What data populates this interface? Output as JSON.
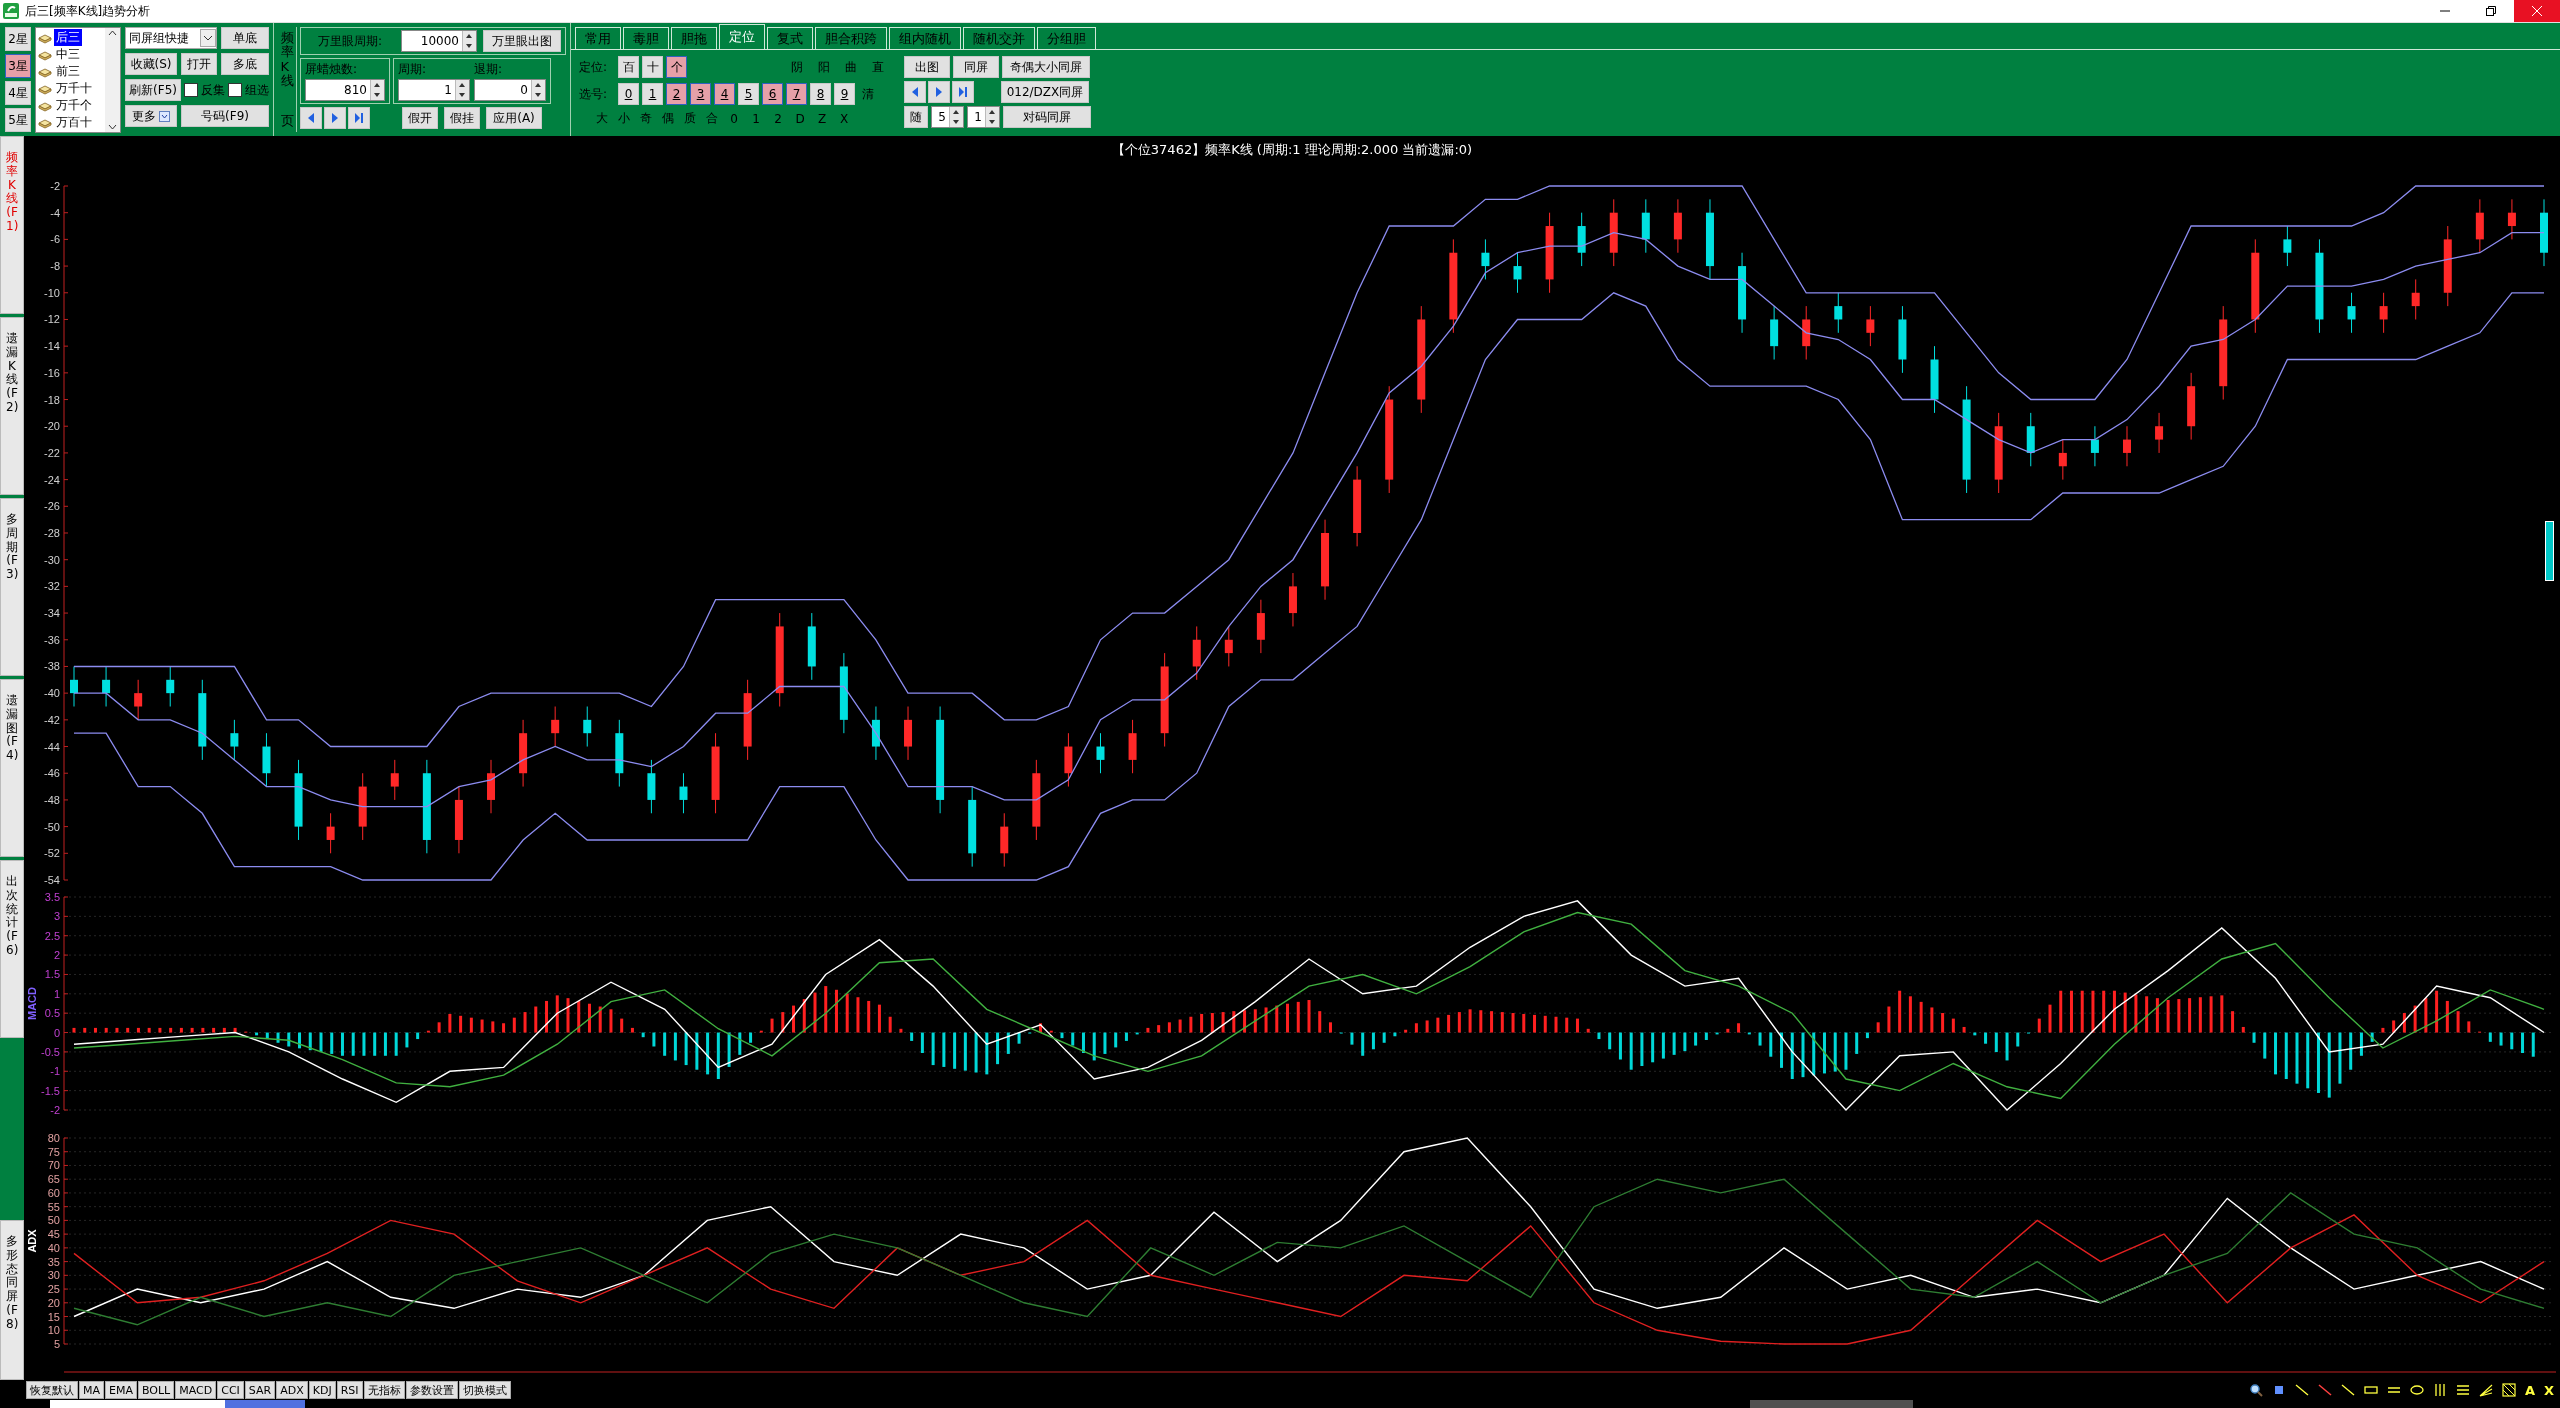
{
  "window": {
    "title": "后三[频率K线]趋势分析"
  },
  "star_buttons": [
    {
      "label": "2星",
      "selected": false
    },
    {
      "label": "3星",
      "selected": true
    },
    {
      "label": "4星",
      "selected": false
    },
    {
      "label": "5星",
      "selected": false
    }
  ],
  "position_list": [
    {
      "label": "后三",
      "selected": true
    },
    {
      "label": "中三",
      "selected": false
    },
    {
      "label": "前三",
      "selected": false
    },
    {
      "label": "万千十",
      "selected": false
    },
    {
      "label": "万千个",
      "selected": false
    },
    {
      "label": "万百十",
      "selected": false
    }
  ],
  "quick_select": {
    "value": "同屏组快捷"
  },
  "buttons": {
    "single": "单底",
    "favorite": "收藏(S)",
    "open": "打开",
    "multi": "多底",
    "refresh": "刷新(F5)",
    "more": "更多",
    "number": "号码(F9)"
  },
  "checkboxes": [
    {
      "label": "反集",
      "checked": false
    },
    {
      "label": "组选",
      "checked": false
    }
  ],
  "frequency_panel": {
    "vertical_label": "频率K线",
    "page_label": "页",
    "wanliyan_label": "万里眼周期:",
    "wanliyan_value": "10000",
    "wanliyan_button": "万里眼出图",
    "candles_label": "屏蜡烛数:",
    "candles_value": "810",
    "period_label": "周期:",
    "period_value": "1",
    "back_label": "退期:",
    "back_value": "0",
    "actions": [
      "假开",
      "假挂",
      "应用(A)"
    ]
  },
  "tabs": [
    {
      "label": "常用",
      "selected": false
    },
    {
      "label": "毒胆",
      "selected": false
    },
    {
      "label": "胆拖",
      "selected": false
    },
    {
      "label": "定位",
      "selected": true
    },
    {
      "label": "复式",
      "selected": false
    },
    {
      "label": "胆合积跨",
      "selected": false
    },
    {
      "label": "组内随机",
      "selected": false
    },
    {
      "label": "随机交并",
      "selected": false
    },
    {
      "label": "分组胆",
      "selected": false
    }
  ],
  "position": {
    "label": "定位:",
    "digits": [
      {
        "label": "百",
        "selected": false
      },
      {
        "label": "十",
        "selected": false
      },
      {
        "label": "个",
        "selected": true
      }
    ],
    "shape_labels": [
      "阴",
      "阳",
      "曲",
      "直"
    ],
    "pick_label": "选号:",
    "numbers": [
      {
        "label": "0",
        "selected": false
      },
      {
        "label": "1",
        "selected": false
      },
      {
        "label": "2",
        "selected": true
      },
      {
        "label": "3",
        "selected": true
      },
      {
        "label": "4",
        "selected": true
      },
      {
        "label": "5",
        "selected": false
      },
      {
        "label": "6",
        "selected": true
      },
      {
        "label": "7",
        "selected": true
      },
      {
        "label": "8",
        "selected": false
      },
      {
        "label": "9",
        "selected": false
      }
    ],
    "clear": "清",
    "filters": [
      "大",
      "小",
      "奇",
      "偶",
      "质",
      "合",
      "0",
      "1",
      "2",
      "D",
      "Z",
      "X"
    ],
    "right_buttons": {
      "chart": "出图",
      "same": "同屏",
      "parity": "奇偶大小同屏",
      "dzx": "012/DZX同屏",
      "random": "随",
      "spin1": "5",
      "spin2": "1",
      "pair": "对码同屏"
    }
  },
  "side_tabs": [
    {
      "label": "频率K线(F1)",
      "selected": true
    },
    {
      "label": "遗漏K线(F2)",
      "selected": false
    },
    {
      "label": "多周期(F3)",
      "selected": false
    },
    {
      "label": "遗漏图(F4)",
      "selected": false
    },
    {
      "label": "出次统计(F6)",
      "selected": false
    },
    {
      "label": "多形态同屏(F8)",
      "selected": false
    }
  ],
  "chart_title": "【个位37462】频率K线 (周期:1 理论周期:2.000 当前遗漏:0)",
  "main_chart": {
    "chart_data": {
      "type": "candlestick",
      "ylim": [
        -54,
        -2
      ],
      "yticks": [
        -2,
        -4,
        -6,
        -8,
        -10,
        -12,
        -14,
        -16,
        -18,
        -20,
        -22,
        -24,
        -26,
        -28,
        -30,
        -32,
        -34,
        -36,
        -38,
        -40,
        -42,
        -44,
        -46,
        -48,
        -50,
        -52,
        -54
      ],
      "categories": [
        null,
        null,
        null,
        null,
        null,
        null,
        null,
        null,
        null,
        null,
        null,
        null,
        null,
        null,
        null,
        null,
        null,
        null,
        null,
        null,
        null,
        null,
        null,
        null,
        null,
        null,
        null,
        null,
        null,
        null,
        null,
        null,
        null,
        null,
        null,
        null,
        null,
        null,
        null,
        null,
        null,
        null,
        null,
        null,
        null,
        null,
        null,
        null,
        null,
        null,
        null,
        null,
        null,
        null,
        null,
        null,
        null,
        null,
        null,
        null,
        null,
        null,
        null,
        null,
        null,
        null,
        null,
        null,
        null,
        null,
        null,
        null,
        null,
        null,
        null,
        null,
        null,
        null
      ],
      "series": [
        {
          "type": "line",
          "color": "#8c8cf0",
          "values": [
            -38,
            -38,
            -38,
            -38,
            -38,
            -38,
            -42,
            -42,
            -44,
            -44,
            -44,
            -44,
            -41,
            -40,
            -40,
            -40,
            -40,
            -40,
            -41,
            -38,
            -33,
            -33,
            -33,
            -33,
            -33,
            -36,
            -40,
            -40,
            -40,
            -42,
            -42,
            -41,
            -36,
            -34,
            -34,
            -32,
            -30,
            -26,
            -22,
            -16,
            -10,
            -5,
            -5,
            -5,
            -3,
            -3,
            -2,
            -2,
            -2,
            -2,
            -2,
            -2,
            -2,
            -6,
            -10,
            -10,
            -10,
            -10,
            -10,
            -13,
            -16,
            -18,
            -18,
            -18,
            -15,
            -10,
            -5,
            -5,
            -5,
            -5,
            -5,
            -5,
            -4,
            -2,
            -2,
            -2,
            -2,
            -2
          ]
        },
        {
          "type": "line",
          "color": "#8c8cf0",
          "values": [
            -40,
            -40,
            -42,
            -42,
            -43,
            -45,
            -47,
            -47,
            -48,
            -48.5,
            -48.5,
            -48.5,
            -47,
            -46.5,
            -45,
            -44,
            -45,
            -45,
            -45.5,
            -44,
            -41.5,
            -41.5,
            -39.5,
            -39.5,
            -39.5,
            -43,
            -47,
            -47,
            -47,
            -48,
            -48,
            -46.5,
            -42,
            -40.5,
            -40.5,
            -38.5,
            -35,
            -32,
            -30,
            -26,
            -22,
            -17.5,
            -15.5,
            -12.5,
            -8.5,
            -7,
            -6.5,
            -6.5,
            -5.5,
            -6,
            -8,
            -9,
            -9,
            -11,
            -13,
            -13.5,
            -15,
            -18,
            -18,
            -19.5,
            -21,
            -22,
            -21,
            -21,
            -19.5,
            -17,
            -14,
            -13.5,
            -12,
            -9.5,
            -9.5,
            -9.5,
            -9,
            -8,
            -7.5,
            -7,
            -5.5,
            -5.5
          ]
        },
        {
          "type": "line",
          "color": "#8c8cf0",
          "values": [
            -43,
            -43,
            -47,
            -47,
            -49,
            -53,
            -53,
            -53,
            -53,
            -54,
            -54,
            -54,
            -54,
            -54,
            -51,
            -49,
            -51,
            -51,
            -51,
            -51,
            -51,
            -51,
            -47,
            -47,
            -47,
            -51,
            -54,
            -54,
            -54,
            -54,
            -54,
            -53,
            -49,
            -48,
            -48,
            -46,
            -41,
            -39,
            -39,
            -37,
            -35,
            -31,
            -27,
            -21,
            -15,
            -12,
            -12,
            -12,
            -10,
            -11,
            -15,
            -17,
            -17,
            -17,
            -17,
            -18,
            -21,
            -27,
            -27,
            -27,
            -27,
            -27,
            -25,
            -25,
            -25,
            -25,
            -24,
            -23,
            -20,
            -15,
            -15,
            -15,
            -15,
            -15,
            -14,
            -13,
            -10,
            -10
          ]
        }
      ],
      "ohlc": [
        [
          -39,
          -38,
          -41,
          -40
        ],
        [
          -39,
          -38,
          -41,
          -40
        ],
        [
          -41,
          -39,
          -42,
          -40
        ],
        [
          -39,
          -38,
          -41,
          -40
        ],
        [
          -40,
          -39,
          -45,
          -44
        ],
        [
          -43,
          -42,
          -45,
          -44
        ],
        [
          -44,
          -43,
          -47,
          -46
        ],
        [
          -46,
          -45,
          -51,
          -50
        ],
        [
          -51,
          -49,
          -52,
          -50
        ],
        [
          -50,
          -46,
          -51,
          -47
        ],
        [
          -47,
          -45,
          -48,
          -46
        ],
        [
          -46,
          -45,
          -52,
          -51
        ],
        [
          -51,
          -47,
          -52,
          -48
        ],
        [
          -48,
          -45,
          -49,
          -46
        ],
        [
          -46,
          -42,
          -47,
          -43
        ],
        [
          -43,
          -41,
          -44,
          -42
        ],
        [
          -42,
          -41,
          -44,
          -43
        ],
        [
          -43,
          -42,
          -47,
          -46
        ],
        [
          -46,
          -45,
          -49,
          -48
        ],
        [
          -47,
          -46,
          -49,
          -48
        ],
        [
          -48,
          -43,
          -49,
          -44
        ],
        [
          -44,
          -39,
          -45,
          -40
        ],
        [
          -40,
          -34,
          -41,
          -35
        ],
        [
          -35,
          -34,
          -39,
          -38
        ],
        [
          -38,
          -37,
          -43,
          -42
        ],
        [
          -42,
          -41,
          -45,
          -44
        ],
        [
          -44,
          -41,
          -45,
          -42
        ],
        [
          -42,
          -41,
          -49,
          -48
        ],
        [
          -48,
          -47,
          -53,
          -52
        ],
        [
          -52,
          -49,
          -53,
          -50
        ],
        [
          -50,
          -45,
          -51,
          -46
        ],
        [
          -46,
          -43,
          -47,
          -44
        ],
        [
          -44,
          -43,
          -46,
          -45
        ],
        [
          -45,
          -42,
          -46,
          -43
        ],
        [
          -43,
          -37,
          -44,
          -38
        ],
        [
          -38,
          -35,
          -39,
          -36
        ],
        [
          -37,
          -35,
          -38,
          -36
        ],
        [
          -36,
          -33,
          -37,
          -34
        ],
        [
          -34,
          -31,
          -35,
          -32
        ],
        [
          -32,
          -27,
          -33,
          -28
        ],
        [
          -28,
          -23,
          -29,
          -24
        ],
        [
          -24,
          -17,
          -25,
          -18
        ],
        [
          -18,
          -11,
          -19,
          -12
        ],
        [
          -12,
          -6,
          -13,
          -7
        ],
        [
          -7,
          -6,
          -9,
          -8
        ],
        [
          -8,
          -7,
          -10,
          -9
        ],
        [
          -9,
          -4,
          -10,
          -5
        ],
        [
          -5,
          -4,
          -8,
          -7
        ],
        [
          -7,
          -3,
          -8,
          -4
        ],
        [
          -4,
          -3,
          -7,
          -6
        ],
        [
          -6,
          -3,
          -7,
          -4
        ],
        [
          -4,
          -3,
          -9,
          -8
        ],
        [
          -8,
          -7,
          -13,
          -12
        ],
        [
          -12,
          -11,
          -15,
          -14
        ],
        [
          -14,
          -11,
          -15,
          -12
        ],
        [
          -11,
          -10,
          -13,
          -12
        ],
        [
          -13,
          -11,
          -14,
          -12
        ],
        [
          -12,
          -11,
          -16,
          -15
        ],
        [
          -15,
          -14,
          -19,
          -18
        ],
        [
          -18,
          -17,
          -25,
          -24
        ],
        [
          -24,
          -19,
          -25,
          -20
        ],
        [
          -20,
          -19,
          -23,
          -22
        ],
        [
          -23,
          -21,
          -24,
          -22
        ],
        [
          -21,
          -20,
          -23,
          -22
        ],
        [
          -22,
          -20,
          -23,
          -21
        ],
        [
          -21,
          -19,
          -22,
          -20
        ],
        [
          -20,
          -16,
          -21,
          -17
        ],
        [
          -17,
          -11,
          -18,
          -12
        ],
        [
          -12,
          -6,
          -13,
          -7
        ],
        [
          -6,
          -5,
          -8,
          -7
        ],
        [
          -7,
          -6,
          -13,
          -12
        ],
        [
          -11,
          -10,
          -13,
          -12
        ],
        [
          -12,
          -10,
          -13,
          -11
        ],
        [
          -11,
          -9,
          -12,
          -10
        ],
        [
          -10,
          -5,
          -11,
          -6
        ],
        [
          -6,
          -3,
          -7,
          -4
        ],
        [
          -5,
          -3,
          -6,
          -4
        ],
        [
          -4,
          -3,
          -8,
          -7
        ]
      ]
    }
  },
  "macd_chart": {
    "chart_data": {
      "type": "line",
      "ylabel": "MACD",
      "ylim": [
        -2,
        3.5
      ],
      "grid": true,
      "yticks": [
        3.5,
        3,
        2.5,
        2,
        1.5,
        1,
        0.5,
        0,
        -0.5,
        -1,
        -1.5,
        -2
      ],
      "series": [
        {
          "color": "#ffffff",
          "values": [
            -0.3,
            -0.2,
            -0.1,
            0,
            -0.5,
            -1.2,
            -1.8,
            -1.0,
            -0.9,
            0.5,
            1.3,
            0.6,
            -0.9,
            -0.3,
            1.5,
            2.4,
            1.2,
            -0.3,
            0.2,
            -1.2,
            -0.9,
            -0.2,
            0.8,
            1.9,
            1.0,
            1.2,
            2.2,
            3.0,
            3.4,
            2.0,
            1.2,
            1.4,
            -0.5,
            -2.0,
            -0.6,
            -0.5,
            -2.0,
            -0.8,
            0.6,
            1.6,
            2.7,
            1.4,
            -0.5,
            -0.3,
            1.2,
            0.9,
            0
          ]
        },
        {
          "color": "#40b040",
          "values": [
            -0.4,
            -0.3,
            -0.2,
            -0.1,
            -0.2,
            -0.7,
            -1.3,
            -1.4,
            -1.1,
            -0.3,
            0.8,
            1.1,
            0.1,
            -0.6,
            0.5,
            1.8,
            1.9,
            0.6,
            0,
            -0.6,
            -1.0,
            -0.6,
            0.3,
            1.2,
            1.5,
            1.0,
            1.7,
            2.6,
            3.1,
            2.8,
            1.6,
            1.2,
            0.5,
            -1.2,
            -1.5,
            -0.8,
            -1.4,
            -1.7,
            -0.3,
            0.9,
            1.9,
            2.3,
            0.9,
            -0.4,
            0.3,
            1.1,
            0.6
          ]
        }
      ]
    }
  },
  "adx_chart": {
    "chart_data": {
      "type": "line",
      "ylabel": "ADX",
      "ylim": [
        5,
        80
      ],
      "grid": true,
      "yticks": [
        80,
        75,
        70,
        65,
        60,
        55,
        50,
        45,
        40,
        35,
        30,
        25,
        20,
        15,
        10,
        5
      ],
      "series": [
        {
          "color": "#ffffff",
          "values": [
            15,
            25,
            20,
            25,
            35,
            22,
            18,
            25,
            22,
            30,
            50,
            55,
            35,
            30,
            45,
            40,
            25,
            30,
            53,
            35,
            50,
            75,
            80,
            55,
            25,
            18,
            22,
            40,
            25,
            30,
            22,
            25,
            20,
            30,
            58,
            40,
            25,
            30,
            35,
            25
          ]
        },
        {
          "color": "#e02020",
          "values": [
            38,
            20,
            22,
            28,
            38,
            50,
            45,
            28,
            20,
            30,
            40,
            25,
            18,
            40,
            30,
            35,
            50,
            30,
            25,
            20,
            15,
            30,
            28,
            48,
            20,
            10,
            6,
            5,
            5,
            10,
            30,
            50,
            35,
            45,
            20,
            40,
            52,
            30,
            20,
            35
          ]
        },
        {
          "color": "#2e7d32",
          "values": [
            18,
            12,
            22,
            15,
            20,
            15,
            30,
            35,
            40,
            30,
            20,
            38,
            45,
            40,
            30,
            20,
            15,
            40,
            30,
            42,
            40,
            48,
            35,
            22,
            55,
            65,
            60,
            65,
            45,
            25,
            22,
            35,
            20,
            30,
            38,
            60,
            45,
            40,
            25,
            18
          ]
        }
      ]
    }
  },
  "indicator_buttons": [
    "恢复默认",
    "MA",
    "EMA",
    "BOLL",
    "MACD",
    "CCI",
    "SAR",
    "ADX",
    "KDJ",
    "RSI",
    "无指标",
    "参数设置",
    "切换模式"
  ],
  "tool_letters": [
    "A",
    "X"
  ]
}
